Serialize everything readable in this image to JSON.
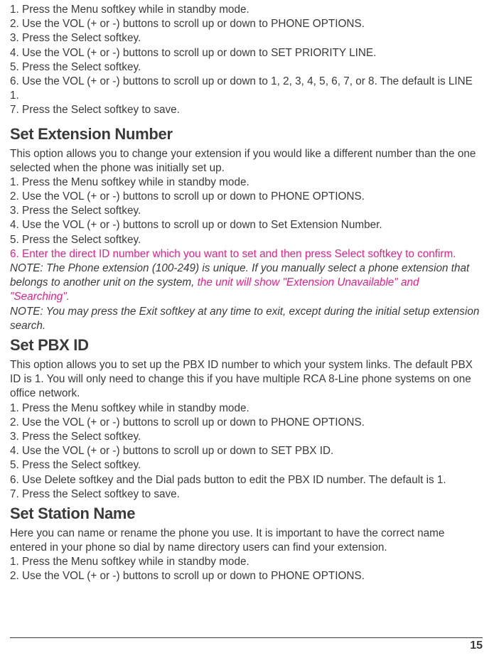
{
  "section1": {
    "line1": "1. Press the Menu softkey while in standby mode.",
    "line2": "2. Use the VOL (+ or -) buttons to scroll up or down to PHONE OPTIONS.",
    "line3": "3. Press the Select softkey.",
    "line4": "4. Use the VOL (+ or -) buttons to scroll up or down to SET PRIORITY LINE.",
    "line5": "5. Press the Select softkey.",
    "line6": "6. Use the VOL (+ or -) buttons to scroll up or down to 1, 2, 3, 4, 5, 6, 7, or 8. The default is LINE 1.",
    "line7": "7. Press the Select softkey to save."
  },
  "section2": {
    "heading": "Set Extension Number",
    "intro": "This option allows you to change your extension if you would like a different number than the one selected when the phone was initially set up.",
    "line1": "1. Press the Menu softkey while in standby mode.",
    "line2": "2. Use the VOL (+ or -) buttons to scroll up or down to PHONE OPTIONS.",
    "line3": "3. Press the Select softkey.",
    "line4": "4. Use the VOL (+ or -) buttons to scroll up or down to Set Extension Number.",
    "line5": "5. Press the Select softkey.",
    "line6_pink": "6. Enter the direct ID number which you want to set and then press Select softkey to confirm.",
    "note1_prefix": "NOTE: The Phone extension (100-249) is unique. If you manually select a phone extension that belongs to another unit on the system, ",
    "note1_pink": "the unit will show \"Extension Unavailable\" and \"Searching\".",
    "note2": "NOTE: You may press the Exit softkey at any time to exit, except during the initial setup extension search."
  },
  "section3": {
    "heading": "Set PBX ID",
    "intro": "This option allows you to set up the PBX ID number to which your system links. The default PBX ID is 1.  You will only need to change this if you have multiple RCA 8-Line phone systems on one office network.",
    "line1": "1. Press the Menu softkey while in standby mode.",
    "line2": "2. Use the VOL (+ or -) buttons to scroll up or down to PHONE OPTIONS.",
    "line3": "3. Press the Select softkey.",
    "line4": "4. Use the VOL (+ or -) buttons to scroll up or down to SET PBX ID.",
    "line5": "5. Press the Select softkey.",
    "line6": "6. Use Delete softkey and the Dial pads button to edit the PBX ID number.  The default is 1.",
    "line7": "7. Press the Select softkey to save."
  },
  "section4": {
    "heading": "Set Station Name",
    "intro": "Here you can name or rename the phone you use.  It is important to have the correct name entered in your phone so dial by name directory users can find your extension.",
    "line1": "1. Press the Menu softkey while in standby mode.",
    "line2": "2. Use the VOL (+ or -) buttons to scroll up or down to PHONE OPTIONS."
  },
  "page_number": "15"
}
